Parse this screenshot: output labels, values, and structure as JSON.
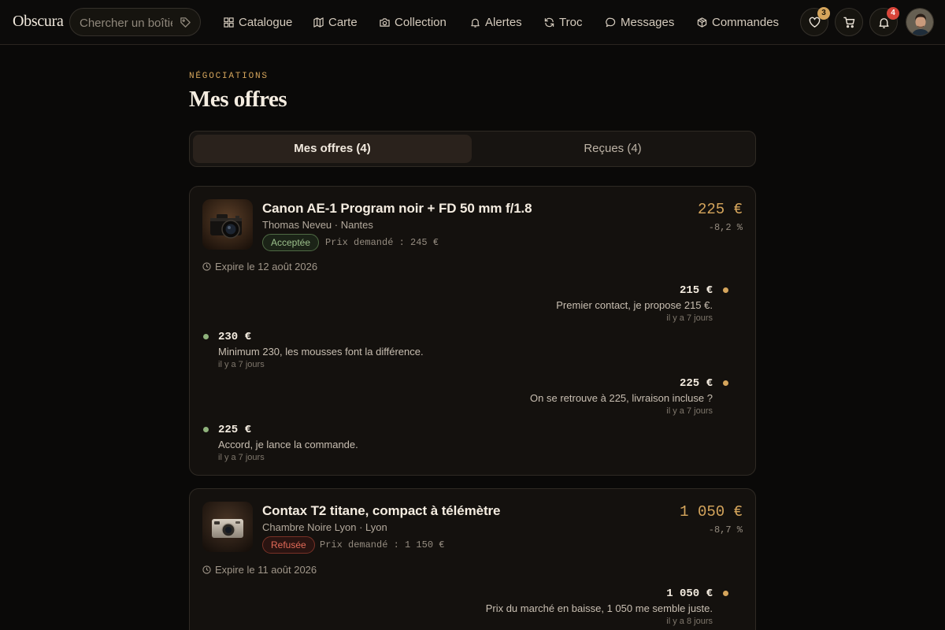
{
  "app": {
    "logo": "Obscura"
  },
  "search": {
    "placeholder": "Chercher un boîtier"
  },
  "nav": [
    {
      "label": "Catalogue",
      "icon": "grid-icon"
    },
    {
      "label": "Carte",
      "icon": "map-icon"
    },
    {
      "label": "Collection",
      "icon": "camera-icon"
    },
    {
      "label": "Alertes",
      "icon": "bell-icon"
    },
    {
      "label": "Troc",
      "icon": "refresh-icon"
    },
    {
      "label": "Messages",
      "icon": "chat-bubble-icon"
    },
    {
      "label": "Commandes",
      "icon": "package-icon"
    }
  ],
  "actions": {
    "wishlist_count": "3",
    "notifications_count": "4"
  },
  "header": {
    "eyebrow": "NÉGOCIATIONS",
    "title": "Mes offres"
  },
  "tabs": [
    {
      "label": "Mes offres (4)",
      "active": true
    },
    {
      "label": "Reçues (4)",
      "active": false
    }
  ],
  "offers": [
    {
      "title": "Canon AE-1 Program noir + FD 50 mm f/1.8",
      "seller": "Thomas Neveu · Nantes",
      "status": "Acceptée",
      "asking": "Prix demandé : 245 €",
      "price": "225 €",
      "delta": "-8,2 %",
      "expires": "Expire le 12 août 2026",
      "messages": [
        {
          "side": "right",
          "amount": "215 €",
          "text": "Premier contact, je propose 215 €.",
          "time": "il y a 7 jours"
        },
        {
          "side": "left",
          "amount": "230 €",
          "text": "Minimum 230, les mousses font la différence.",
          "time": "il y a 7 jours"
        },
        {
          "side": "right",
          "amount": "225 €",
          "text": "On se retrouve à 225, livraison incluse ?",
          "time": "il y a 7 jours"
        },
        {
          "side": "left",
          "amount": "225 €",
          "text": "Accord, je lance la commande.",
          "time": "il y a 7 jours"
        }
      ]
    },
    {
      "title": "Contax T2 titane, compact à télémètre",
      "seller": "Chambre Noire Lyon · Lyon",
      "status": "Refusée",
      "asking": "Prix demandé : 1 150 €",
      "price": "1 050 €",
      "delta": "-8,7 %",
      "expires": "Expire le 11 août 2026",
      "messages": [
        {
          "side": "right",
          "amount": "1 050 €",
          "text": "Prix du marché en baisse, 1 050 me semble juste.",
          "time": "il y a 8 jours"
        }
      ]
    }
  ],
  "colors": {
    "accent": "#d5a55c",
    "accepted": "#9cc08c",
    "refused": "#e36a58",
    "background": "#0a0908"
  }
}
